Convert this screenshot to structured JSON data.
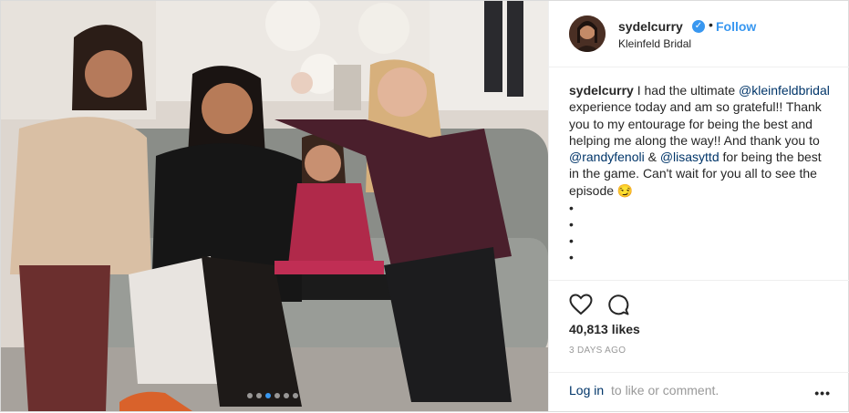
{
  "post": {
    "username": "sydelcurry",
    "follow_label": "Follow",
    "separator": "•",
    "location": "Kleinfeld Bridal",
    "caption_user": "sydelcurry",
    "caption_part1": " I had the ultimate ",
    "mention1": "@kleinfeldbridal",
    "caption_part2": " experience today and am so grateful!! Thank you to my entourage for being the best and helping me along the way!! And thank you to ",
    "mention2": "@randyfenoli",
    "caption_part3": " & ",
    "mention3": "@lisasyttd",
    "caption_part4": " for being the best in the game. Can't wait for you all to see the episode 😏",
    "bullets": [
      "•",
      "•",
      "•",
      "•"
    ],
    "likes": "40,813 likes",
    "date": "3 DAYS AGO",
    "login_link": "Log in",
    "login_rest": " to like or comment.",
    "more": "•••"
  },
  "carousel": {
    "count": 6,
    "active_index": 2
  },
  "colors": {
    "accent": "#3897f0",
    "link": "#003569",
    "muted": "#999999"
  },
  "icons": [
    "verified-badge-icon",
    "heart-icon",
    "comment-icon",
    "more-options-icon"
  ]
}
